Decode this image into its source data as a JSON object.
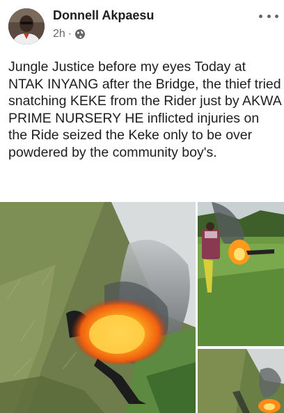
{
  "post": {
    "author_name": "Donnell Akpaesu",
    "timestamp": "2h",
    "separator": "·",
    "audience_icon": "globe-icon",
    "more_icon": "more-options-icon",
    "text": "Jungle Justice before my eyes Today at NTAK INYANG after the Bridge, the thief tried snatching KEKE from the Rider just by AKWA PRIME NURSERY HE inflicted injuries on the Ride seized the Keke only to be over powdered by the community boy's."
  },
  "photos": [
    {
      "id": "main",
      "description_icon": "photo-fire-grass-icon"
    },
    {
      "id": "side-1",
      "description_icon": "photo-crowd-fire-icon"
    },
    {
      "id": "side-2",
      "description_icon": "photo-hillside-fire-icon"
    }
  ],
  "colors": {
    "text": "#1c1e21",
    "meta": "#65676b",
    "background": "#ffffff"
  }
}
